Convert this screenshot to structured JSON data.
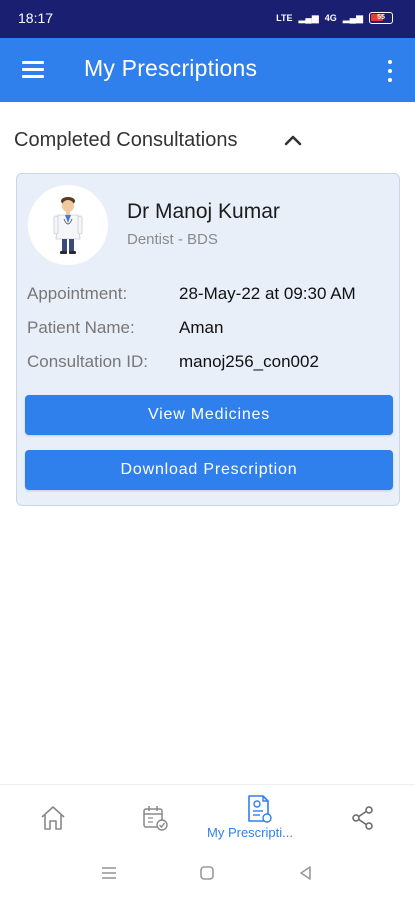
{
  "status_bar": {
    "time": "18:17",
    "indicators": [
      "LTE",
      "4G",
      "Vo LTE",
      "battery 55"
    ],
    "battery_level": "55"
  },
  "app_bar": {
    "title": "My Prescriptions",
    "menu_icon": "hamburger-menu-icon",
    "overflow_icon": "more-vertical-icon"
  },
  "section": {
    "title": "Completed Consultations",
    "expanded": true
  },
  "consultation": {
    "doctor_name": "Dr Manoj Kumar",
    "specialty": "Dentist - BDS",
    "fields": [
      {
        "label": "Appointment:",
        "value": "28-May-22 at 09:30 AM"
      },
      {
        "label": "Patient Name:",
        "value": "Aman"
      },
      {
        "label": "Consultation ID:",
        "value": "manoj256_con002"
      }
    ],
    "buttons": {
      "view_medicines": "View Medicines",
      "download_prescription": "Download Prescription"
    }
  },
  "bottom_nav": {
    "items": [
      {
        "icon": "home-icon",
        "label": ""
      },
      {
        "icon": "calendar-check-icon",
        "label": ""
      },
      {
        "icon": "prescription-icon",
        "label": "My Prescripti..."
      },
      {
        "icon": "share-icon",
        "label": ""
      }
    ],
    "active_index": 2
  },
  "colors": {
    "status_bar": "#1a1f71",
    "primary": "#2f80ed",
    "card_bg": "#e8eff9",
    "label_gray": "#777777"
  }
}
